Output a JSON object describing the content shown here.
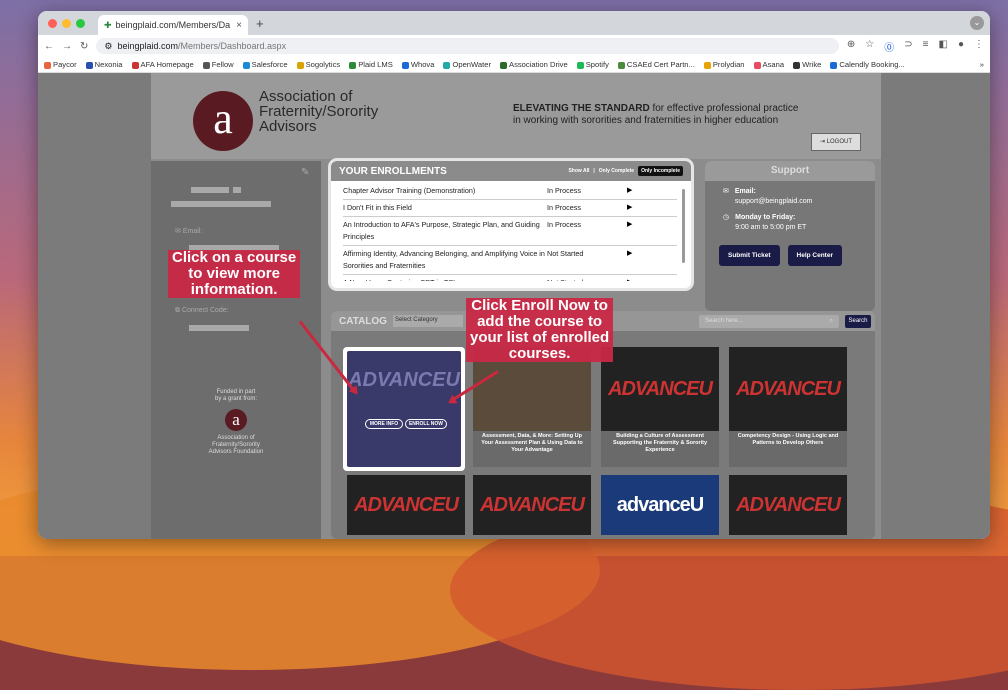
{
  "browser": {
    "tab_title": "beingplaid.com/Members/Da",
    "url_domain": "beingplaid.com",
    "url_path": "/Members/Dashboard.aspx",
    "bookmarks": [
      "Paycor",
      "Nexonia",
      "AFA Homepage",
      "Fellow",
      "Salesforce",
      "Sogolytics",
      "Plaid LMS",
      "Whova",
      "OpenWater",
      "Association Drive",
      "Spotify",
      "CSAEd Cert Partn...",
      "Prolydian",
      "Asana",
      "Wrike",
      "Calendly Booking..."
    ],
    "bookmark_more": "»"
  },
  "header": {
    "org_line1": "Association of",
    "org_line2": "Fraternity/Sorority",
    "org_line3": "Advisors",
    "tagline_bold": "ELEVATING THE STANDARD",
    "tagline_rest": " for effective professional practice",
    "tagline_line2": "in working with sororities and fraternities in higher education",
    "logout": "LOGOUT"
  },
  "sidebar": {
    "email_label": "Email:",
    "connect_label": "Connect Code:",
    "funded_line1": "Funded in part",
    "funded_line2": "by a grant from:",
    "foundation_line1": "Association of",
    "foundation_line2": "Fraternity/Sorority",
    "foundation_line3": "Advisors Foundation"
  },
  "enrollments": {
    "title": "YOUR ENROLLMENTS",
    "filter_all": "Show All",
    "filter_complete": "Only Complete",
    "filter_incomplete": "Only Incomplete",
    "rows": [
      {
        "name": "Chapter Advisor Training (Demonstration)",
        "status": "In Process"
      },
      {
        "name": "I Don't Fit in this Field",
        "status": "In Process"
      },
      {
        "name": "An Introduction to AFA's Purpose, Strategic Plan, and Guiding Principles",
        "status": "In Process"
      },
      {
        "name": "Affirming Identity, Advancing Belonging, and Amplifying Voice in Sororities and Fraternities",
        "status": "Not Started"
      },
      {
        "name": "A New Hope: Centering CPT in FSL",
        "status": "Not Started"
      }
    ]
  },
  "support": {
    "title": "Support",
    "email_label": "Email:",
    "email": "support@beingplaid.com",
    "hours_label": "Monday to Friday:",
    "hours": "9:00 am to 5:00 pm ET",
    "submit": "Submit Ticket",
    "help": "Help Center"
  },
  "catalog": {
    "title": "CATALOG",
    "select_placeholder": "Select Category",
    "search_placeholder": "Search here...",
    "search_button": "Search",
    "more_info": "MORE INFO",
    "enroll_now": "ENROLL NOW",
    "cards": [
      {
        "desc": "Assessment, Data, & More: Setting Up Your Assessment Plan & Using Data to Your Advantage"
      },
      {
        "desc": "Building a Culture of Assessment Supporting the Fraternity & Sorority Experience"
      },
      {
        "desc": "Competency Design - Using Logic and Patterns to Develop Others"
      }
    ],
    "brand_text": "ADVANCE",
    "brand_u": "U",
    "brand_lower": "advance"
  },
  "callouts": {
    "left": [
      "Click on a course",
      "to view more",
      "information."
    ],
    "right": [
      "Click Enroll Now to",
      "add the course to",
      "your list of enrolled",
      "courses."
    ]
  },
  "colors": {
    "accent": "#c9283e",
    "navy": "#1b1b47",
    "maroon": "#5a1a22"
  }
}
